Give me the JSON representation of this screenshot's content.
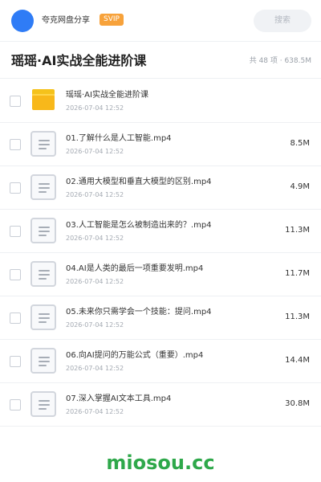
{
  "header": {
    "app_name": "夸克网盘分享",
    "badge": "SVIP",
    "search_placeholder": "搜索"
  },
  "folder": {
    "title": "瑶瑶·AI实战全能进阶课",
    "summary": "共 48 项 · 638.5M"
  },
  "items": [
    {
      "type": "folder",
      "icon": "folder-icon",
      "name": "瑶瑶·AI实战全能进阶课",
      "date": "2026-07-04 12:52",
      "size": ""
    },
    {
      "type": "file",
      "icon": "document-icon",
      "name": "01.了解什么是人工智能.mp4",
      "date": "2026-07-04 12:52",
      "size": "8.5M"
    },
    {
      "type": "file",
      "icon": "document-icon",
      "name": "02.通用大模型和垂直大模型的区别.mp4",
      "date": "2026-07-04 12:52",
      "size": "4.9M"
    },
    {
      "type": "file",
      "icon": "document-icon",
      "name": "03.人工智能是怎么被制造出来的？.mp4",
      "date": "2026-07-04 12:52",
      "size": "11.3M"
    },
    {
      "type": "file",
      "icon": "document-icon",
      "name": "04.AI是人类的最后一项重要发明.mp4",
      "date": "2026-07-04 12:52",
      "size": "11.7M"
    },
    {
      "type": "file",
      "icon": "document-icon",
      "name": "05.未来你只需学会一个技能：提问.mp4",
      "date": "2026-07-04 12:52",
      "size": "11.3M"
    },
    {
      "type": "file",
      "icon": "document-icon",
      "name": "06.向AI提问的万能公式（重要）.mp4",
      "date": "2026-07-04 12:52",
      "size": "14.4M"
    },
    {
      "type": "file",
      "icon": "document-icon",
      "name": "07.深入掌握AI文本工具.mp4",
      "date": "2026-07-04 12:52",
      "size": "30.8M"
    }
  ],
  "watermark": "miosou.cc",
  "colors": {
    "avatar": "#2f7cf6",
    "badge": "#f7a23b",
    "folder": "#f8b81a",
    "watermark": "#2ea84a"
  }
}
